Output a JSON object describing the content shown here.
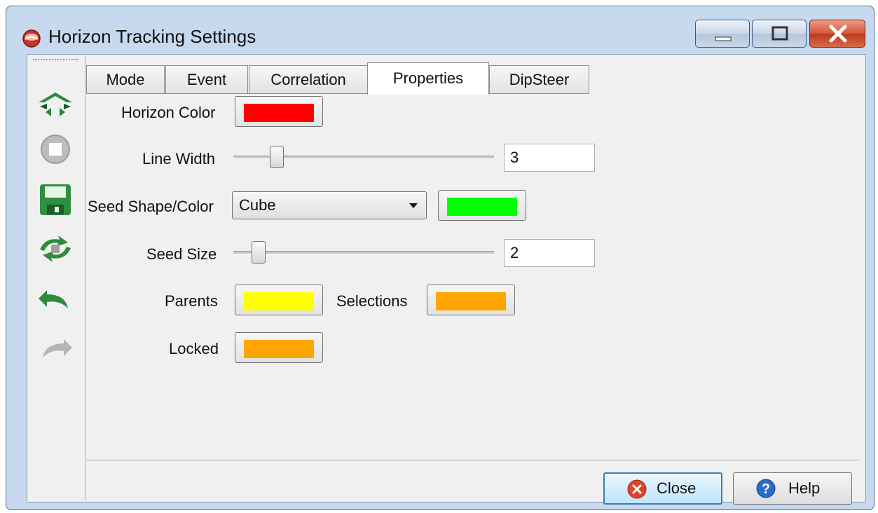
{
  "window": {
    "title": "Horizon Tracking Settings",
    "icon": "horizon-app-icon",
    "controls": [
      "minimize-icon",
      "maximize-icon",
      "close-icon"
    ]
  },
  "toolbar": {
    "items": [
      {
        "name": "track-horizon",
        "icon": "horizon-track-icon",
        "enabled": true
      },
      {
        "name": "stop",
        "icon": "stop-icon",
        "enabled": false
      },
      {
        "name": "save",
        "icon": "save-icon",
        "enabled": true
      },
      {
        "name": "retrack",
        "icon": "retrack-icon",
        "enabled": true
      },
      {
        "name": "undo",
        "icon": "undo-icon",
        "enabled": true
      },
      {
        "name": "redo",
        "icon": "redo-icon",
        "enabled": false
      }
    ]
  },
  "tabs": [
    {
      "label": "Mode",
      "active": false
    },
    {
      "label": "Event",
      "active": false
    },
    {
      "label": "Correlation",
      "active": false
    },
    {
      "label": "Properties",
      "active": true
    },
    {
      "label": "DipSteer",
      "active": false
    }
  ],
  "properties": {
    "horizon_color_label": "Horizon Color",
    "horizon_color": "#ff0000",
    "line_width_label": "Line Width",
    "line_width_value": "3",
    "seed_shape_label": "Seed Shape/Color",
    "seed_shape_value": "Cube",
    "seed_color": "#00ff00",
    "seed_size_label": "Seed Size",
    "seed_size_value": "2",
    "parents_label": "Parents",
    "parents_color": "#ffff00",
    "selections_label": "Selections",
    "selections_color": "#ffa500",
    "locked_label": "Locked",
    "locked_color": "#ffa500"
  },
  "buttons": {
    "close_label": "Close",
    "help_label": "Help"
  }
}
